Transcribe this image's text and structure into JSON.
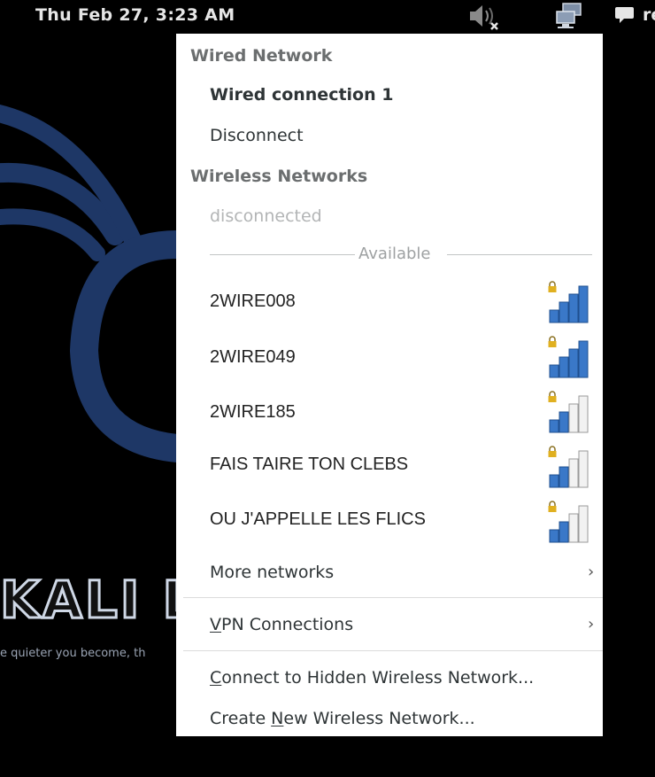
{
  "topbar": {
    "clock": "Thu Feb 27,  3:23 AM",
    "user_fragment": "re",
    "icons": [
      "speaker-muted-icon",
      "network-wired-icon",
      "chat-icon"
    ]
  },
  "wallpaper": {
    "logo_text": "KALI L",
    "slogan": "e quieter you become, th"
  },
  "menu": {
    "wired_title": "Wired Network",
    "wired_connection": "Wired connection 1",
    "disconnect": "Disconnect",
    "wireless_title": "Wireless Networks",
    "wireless_status": "disconnected",
    "available_label": "Available",
    "networks": [
      {
        "ssid": "2WIRE008",
        "locked": true,
        "signal_bars": 4
      },
      {
        "ssid": "2WIRE049",
        "locked": true,
        "signal_bars": 4
      },
      {
        "ssid": "2WIRE185",
        "locked": true,
        "signal_bars": 2
      },
      {
        "ssid": "FAIS TAIRE TON CLEBS",
        "locked": true,
        "signal_bars": 2
      },
      {
        "ssid": "OU J'APPELLE LES FLICS",
        "locked": true,
        "signal_bars": 2
      }
    ],
    "more_networks": "More networks",
    "vpn_mnemonic": "V",
    "vpn_rest": "PN Connections",
    "connect_hidden_mnemonic": "C",
    "connect_hidden_rest": "onnect to Hidden Wireless Network...",
    "create_new_prefix": "Create ",
    "create_new_mnemonic": "N",
    "create_new_rest": "ew Wireless Network..."
  },
  "colors": {
    "menu_bg": "#ffffff",
    "panel_bg": "#000000",
    "signal_fill": "#3a78c8",
    "lock": "#e0b020"
  }
}
